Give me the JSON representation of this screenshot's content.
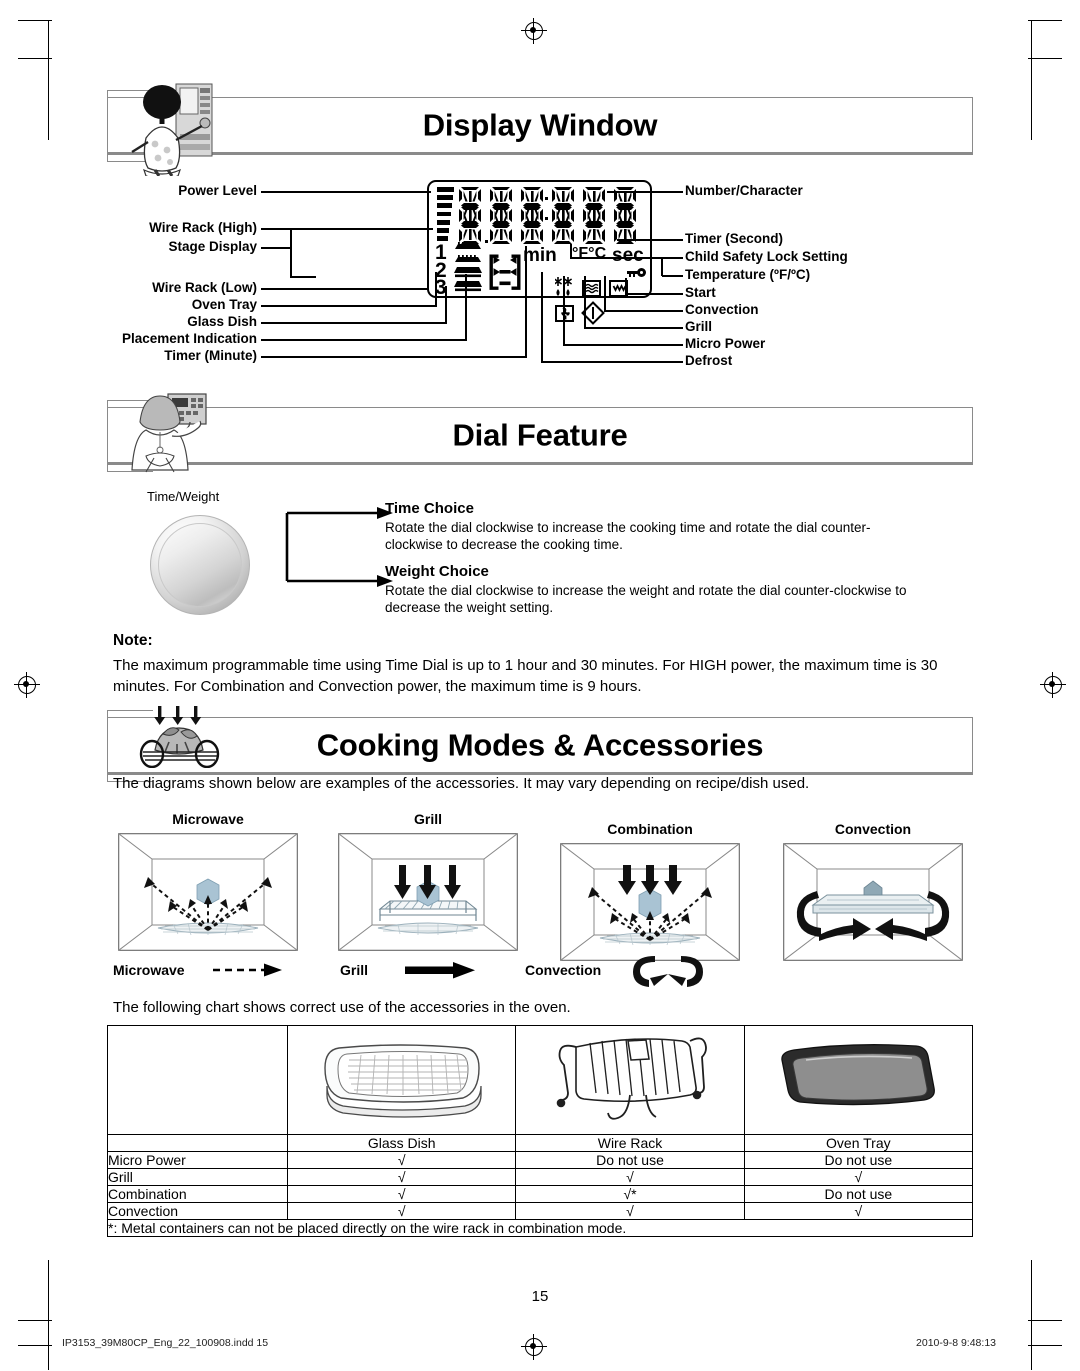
{
  "page": {
    "number": "15",
    "footer_left": "IP3153_39M80CP_Eng_22_100908.indd   15",
    "footer_right": "2010-9-8   9:48:13"
  },
  "display_window": {
    "title": "Display Window",
    "mascot_icon": "person-at-microwave-icon",
    "labels_left": [
      "Power Level",
      "Wire Rack (High)",
      "Stage Display",
      "Wire Rack (Low)",
      "Oven Tray",
      "Glass Dish",
      "Placement Indication",
      "Timer (Minute)"
    ],
    "labels_right": [
      "Number/Character",
      "Timer (Second)",
      "Child Safety Lock Setting",
      "Temperature (ºF/ºC)",
      "Start",
      "Convection",
      "Grill",
      "Micro Power",
      "Defrost"
    ],
    "lcd": {
      "stage_numbers": [
        "1",
        "2",
        "3"
      ],
      "unit_min": "min",
      "unit_temp": "°F°C",
      "unit_sec": "sec",
      "power_bar_count": 7,
      "digit_count": 6,
      "icons": [
        "defrost-asterisk-icon",
        "defrost-droplet-icon",
        "micro-power-wave-icon",
        "grill-element-icon",
        "convection-fan-icon",
        "start-diamond-icon",
        "child-lock-key-icon"
      ]
    }
  },
  "dial_feature": {
    "title": "Dial Feature",
    "mascot_icon": "person-holding-panel-icon",
    "knob_label": "Time/Weight",
    "choices": [
      {
        "heading": "Time Choice",
        "text": "Rotate the dial clockwise to increase the cooking time and rotate the dial counter-clockwise to decrease the cooking time."
      },
      {
        "heading": "Weight Choice",
        "text": "Rotate the dial clockwise to increase the weight and rotate the dial counter-clockwise to decrease the weight setting."
      }
    ],
    "note_heading": "Note:",
    "note_text": "The maximum programmable time using Time Dial is up to 1 hour and 30 minutes. For HIGH power, the maximum time is 30 minutes. For Combination and Convection power, the maximum time is 9 hours."
  },
  "cooking_modes": {
    "title": "Cooking Modes & Accessories",
    "mascot_icon": "roast-chicken-on-rack-icon",
    "intro": "The diagrams shown below are examples of the accessories. It may vary depending on recipe/dish used.",
    "figures": [
      {
        "caption": "Microwave"
      },
      {
        "caption": "Grill"
      },
      {
        "caption": "Combination"
      },
      {
        "caption": "Convection"
      }
    ],
    "legend": [
      {
        "label": "Microwave",
        "symbol": "dashed-arrow-icon"
      },
      {
        "label": "Grill",
        "symbol": "solid-arrow-icon"
      },
      {
        "label": "Convection",
        "symbol": "circular-arrows-icon"
      }
    ],
    "chart_intro": "The following chart shows correct use of the accessories in the oven."
  },
  "accessory_table": {
    "columns": [
      "",
      "Glass Dish",
      "Wire Rack",
      "Oven Tray"
    ],
    "column_icons": [
      "",
      "glass-dish-icon",
      "wire-rack-icon",
      "oven-tray-icon"
    ],
    "rows": [
      {
        "mode": "Micro Power",
        "cells": [
          "√",
          "Do not use",
          "Do not use"
        ]
      },
      {
        "mode": "Grill",
        "cells": [
          "√",
          "√",
          "√"
        ]
      },
      {
        "mode": "Combination",
        "cells": [
          "√",
          "√*",
          "Do not use"
        ]
      },
      {
        "mode": "Convection",
        "cells": [
          "√",
          "√",
          "√"
        ]
      }
    ],
    "footnote": "*: Metal containers can not be placed directly on the wire rack in combination mode."
  }
}
